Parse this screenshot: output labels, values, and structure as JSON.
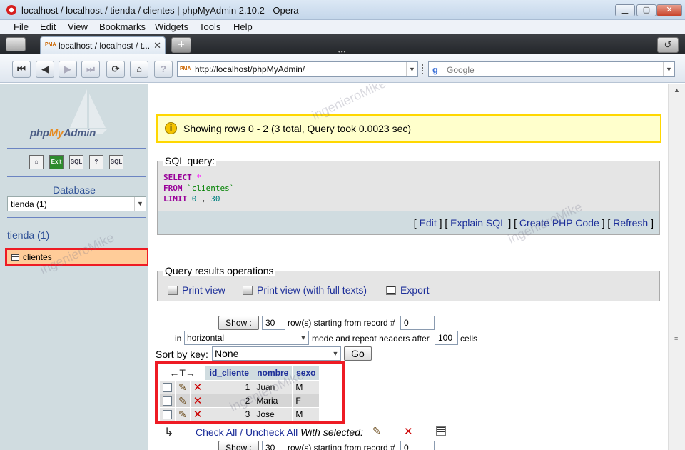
{
  "window": {
    "title": "localhost / localhost / tienda / clientes | phpMyAdmin 2.10.2 - Opera",
    "minimize": "▁",
    "maximize": "▢",
    "close": "✕"
  },
  "menu": [
    "File",
    "Edit",
    "View",
    "Bookmarks",
    "Widgets",
    "Tools",
    "Help"
  ],
  "tabs": [
    {
      "label": "localhost / localhost / t...",
      "favicon": "PMA",
      "close": "✕"
    }
  ],
  "tabbar": {
    "new_tab": "+",
    "trash": "↺"
  },
  "nav": {
    "buttons": [
      "⏮",
      "◀",
      "▶",
      "⏭",
      "⟳",
      "⌂",
      "?"
    ],
    "address": "http://localhost/phpMyAdmin/",
    "address_favicon": "PMA",
    "search_placeholder": "Google",
    "search_logo": "g"
  },
  "sidebar": {
    "logo_php": "php",
    "logo_my": "My",
    "logo_admin": "Admin",
    "icon_buttons": [
      "home-icon",
      "exit-icon",
      "sql-icon",
      "docs-icon",
      "sql-docs-icon"
    ],
    "icon_labels": [
      "⌂",
      "Exit",
      "SQL",
      "?",
      "SQL"
    ],
    "database_label": "Database",
    "database_select": "tienda (1)",
    "db_heading": "tienda (1)",
    "tables": [
      "clientes"
    ]
  },
  "main": {
    "notice": "Showing rows 0 - 2 (3 total, Query took 0.0023 sec)",
    "notice_icon": "i",
    "sql_legend": "SQL query:",
    "sql": {
      "line1_kw": "SELECT",
      "line1_rest": "*",
      "line2_kw": "FROM",
      "line2_rest": "`clientes`",
      "line3_kw": "LIMIT",
      "line3_a": "0",
      "line3_sep": ",",
      "line3_b": "30"
    },
    "sql_links": [
      "Edit",
      "Explain SQL",
      "Create PHP Code",
      "Refresh"
    ],
    "qr_legend": "Query results operations",
    "qr_ops": [
      "Print view",
      "Print view (with full texts)",
      "Export"
    ],
    "nav_form": {
      "show_button": "Show :",
      "rows_value": "30",
      "rows_text": "row(s) starting from record #",
      "start_value": "0",
      "in_text": "in",
      "mode_value": "horizontal",
      "mode_text": "mode and repeat headers after",
      "repeat_value": "100",
      "cells_text": "cells"
    },
    "sort": {
      "label": "Sort by key:",
      "value": "None",
      "go": "Go"
    },
    "table": {
      "arrow_header": "←T→",
      "columns": [
        "id_cliente",
        "nombre",
        "sexo"
      ],
      "rows": [
        {
          "id": "1",
          "nombre": "Juan",
          "sexo": "M"
        },
        {
          "id": "2",
          "nombre": "Maria",
          "sexo": "F"
        },
        {
          "id": "3",
          "nombre": "Jose",
          "sexo": "M"
        }
      ]
    },
    "bottom": {
      "check_all": "Check All",
      "separator": "/",
      "uncheck_all": "Uncheck All",
      "with_selected": "With selected:"
    },
    "watermark": "ingenieroMike"
  }
}
